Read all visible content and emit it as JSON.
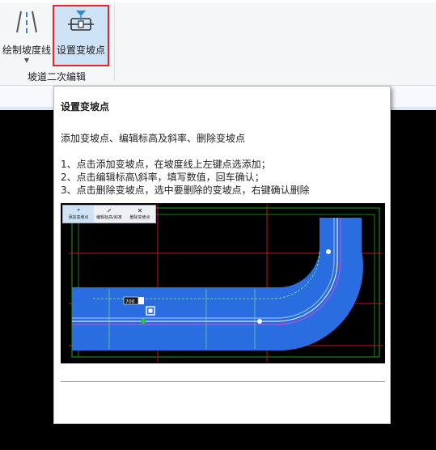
{
  "ribbon": {
    "buttons": [
      {
        "label": "绘制坡度线",
        "icon": "road-lines-icon",
        "has_dropdown": true
      },
      {
        "label": "设置变坡点",
        "icon": "slope-point-icon",
        "highlighted": true
      }
    ],
    "group_label": "坡道二次编辑"
  },
  "tooltip": {
    "title": "设置变坡点",
    "description": "添加变坡点、编辑标高及斜率、删除变坡点",
    "steps": [
      "1、点击添加变坡点，在坡度线上左键点选添加；",
      "2、点击编辑标高\\斜率，填写数值，回车确认；",
      "3、点击删除变坡点，选中要删除的变坡点，右键确认删除"
    ],
    "preview": {
      "toolbar": [
        "添加变坡点",
        "编辑标高/斜率",
        "删除变坡点"
      ],
      "input_value": "700"
    }
  },
  "colors": {
    "highlight_border": "#e6252f",
    "selected_bg": "#cfe3f6",
    "ramp_fill": "#2a6de0",
    "grid_red": "#c0131b",
    "grid_green": "#1fa025"
  }
}
